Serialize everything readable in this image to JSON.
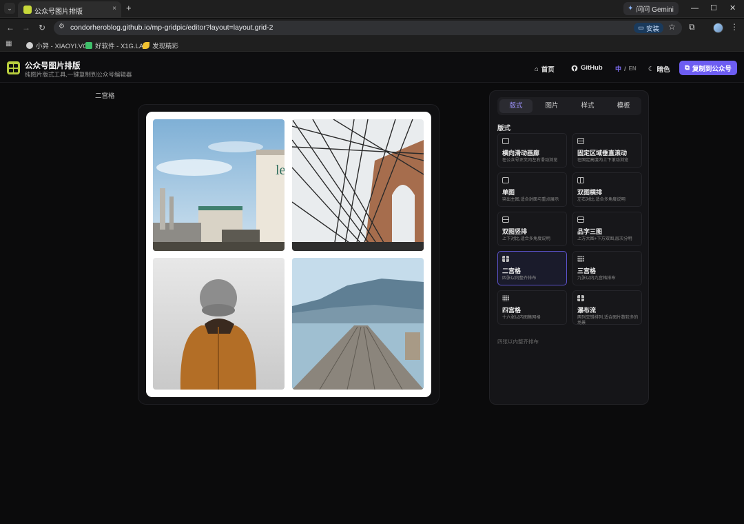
{
  "browser": {
    "tab_title": "公众号图片排版",
    "tab_close": "×",
    "new_tab": "+",
    "gemini_label": "问问 Gemini",
    "url": "condorheroblog.github.io/mp-gridpic/editor?layout=layout.grid-2",
    "install_label": "安装",
    "bookmarks": [
      {
        "label": "小羿 - XIAOYI.VC",
        "color": "#d0d0d0"
      },
      {
        "label": "好软件 - X1G.LA",
        "color": "#3fbf6a"
      },
      {
        "label": "发现精彩",
        "color": "#f2c230"
      }
    ]
  },
  "app": {
    "title": "公众号图片排版",
    "subtitle": "纯图片版式工具,一键复制到公众号编辑器",
    "nav": {
      "home": "首页",
      "github": "GitHub",
      "lang_zh": "中",
      "lang_sep": "/",
      "lang_en": "EN",
      "theme": "暗色",
      "copy_button": "复制到公众号"
    },
    "accent_color": "#6d5df2"
  },
  "canvas": {
    "layout_label": "二宫格",
    "photos": [
      {
        "name": "industrial-tanks",
        "subject": "industrial storage tanks under blue sky"
      },
      {
        "name": "bridge-cables",
        "subject": "suspension bridge cables and stone arch"
      },
      {
        "name": "person-beanie",
        "subject": "person in orange jacket and knit hat in fog"
      },
      {
        "name": "lake-dock",
        "subject": "wooden pier into mountain lake"
      }
    ]
  },
  "panel": {
    "tabs": [
      "版式",
      "图片",
      "样式",
      "模板"
    ],
    "active_tab": "版式",
    "section_title": "版式",
    "options": [
      {
        "name": "横向滑动画廊",
        "desc": "在公众号正文内左右滑动浏览",
        "icon": "horizontal-slide-icon",
        "selected": false
      },
      {
        "name": "固定区域垂直滚动",
        "desc": "在固定高度内上下滚动浏览",
        "icon": "vertical-scroll-icon",
        "selected": false
      },
      {
        "name": "单图",
        "desc": "突出主图,适合封面与重点展示",
        "icon": "single-image-icon",
        "selected": false
      },
      {
        "name": "双图横排",
        "desc": "左右对比,适合多角度说明",
        "icon": "two-column-icon",
        "selected": false
      },
      {
        "name": "双图竖排",
        "desc": "上下对比,适合多角度说明",
        "icon": "two-row-icon",
        "selected": false
      },
      {
        "name": "品字三图",
        "desc": "上方大图+下方双图,层次分明",
        "icon": "pin-three-icon",
        "selected": false
      },
      {
        "name": "二宫格",
        "desc": "四张以内整齐排布",
        "icon": "grid-2x2-icon",
        "selected": true
      },
      {
        "name": "三宫格",
        "desc": "九张以内九宫格排布",
        "icon": "grid-3x3-icon",
        "selected": false
      },
      {
        "name": "四宫格",
        "desc": "十六张以内图集网格",
        "icon": "grid-4x4-icon",
        "selected": false
      },
      {
        "name": "瀑布流",
        "desc": "两列交错排列,适合图片数较多的场景",
        "icon": "waterfall-icon",
        "selected": false
      }
    ],
    "note": "四张以内整齐排布"
  }
}
